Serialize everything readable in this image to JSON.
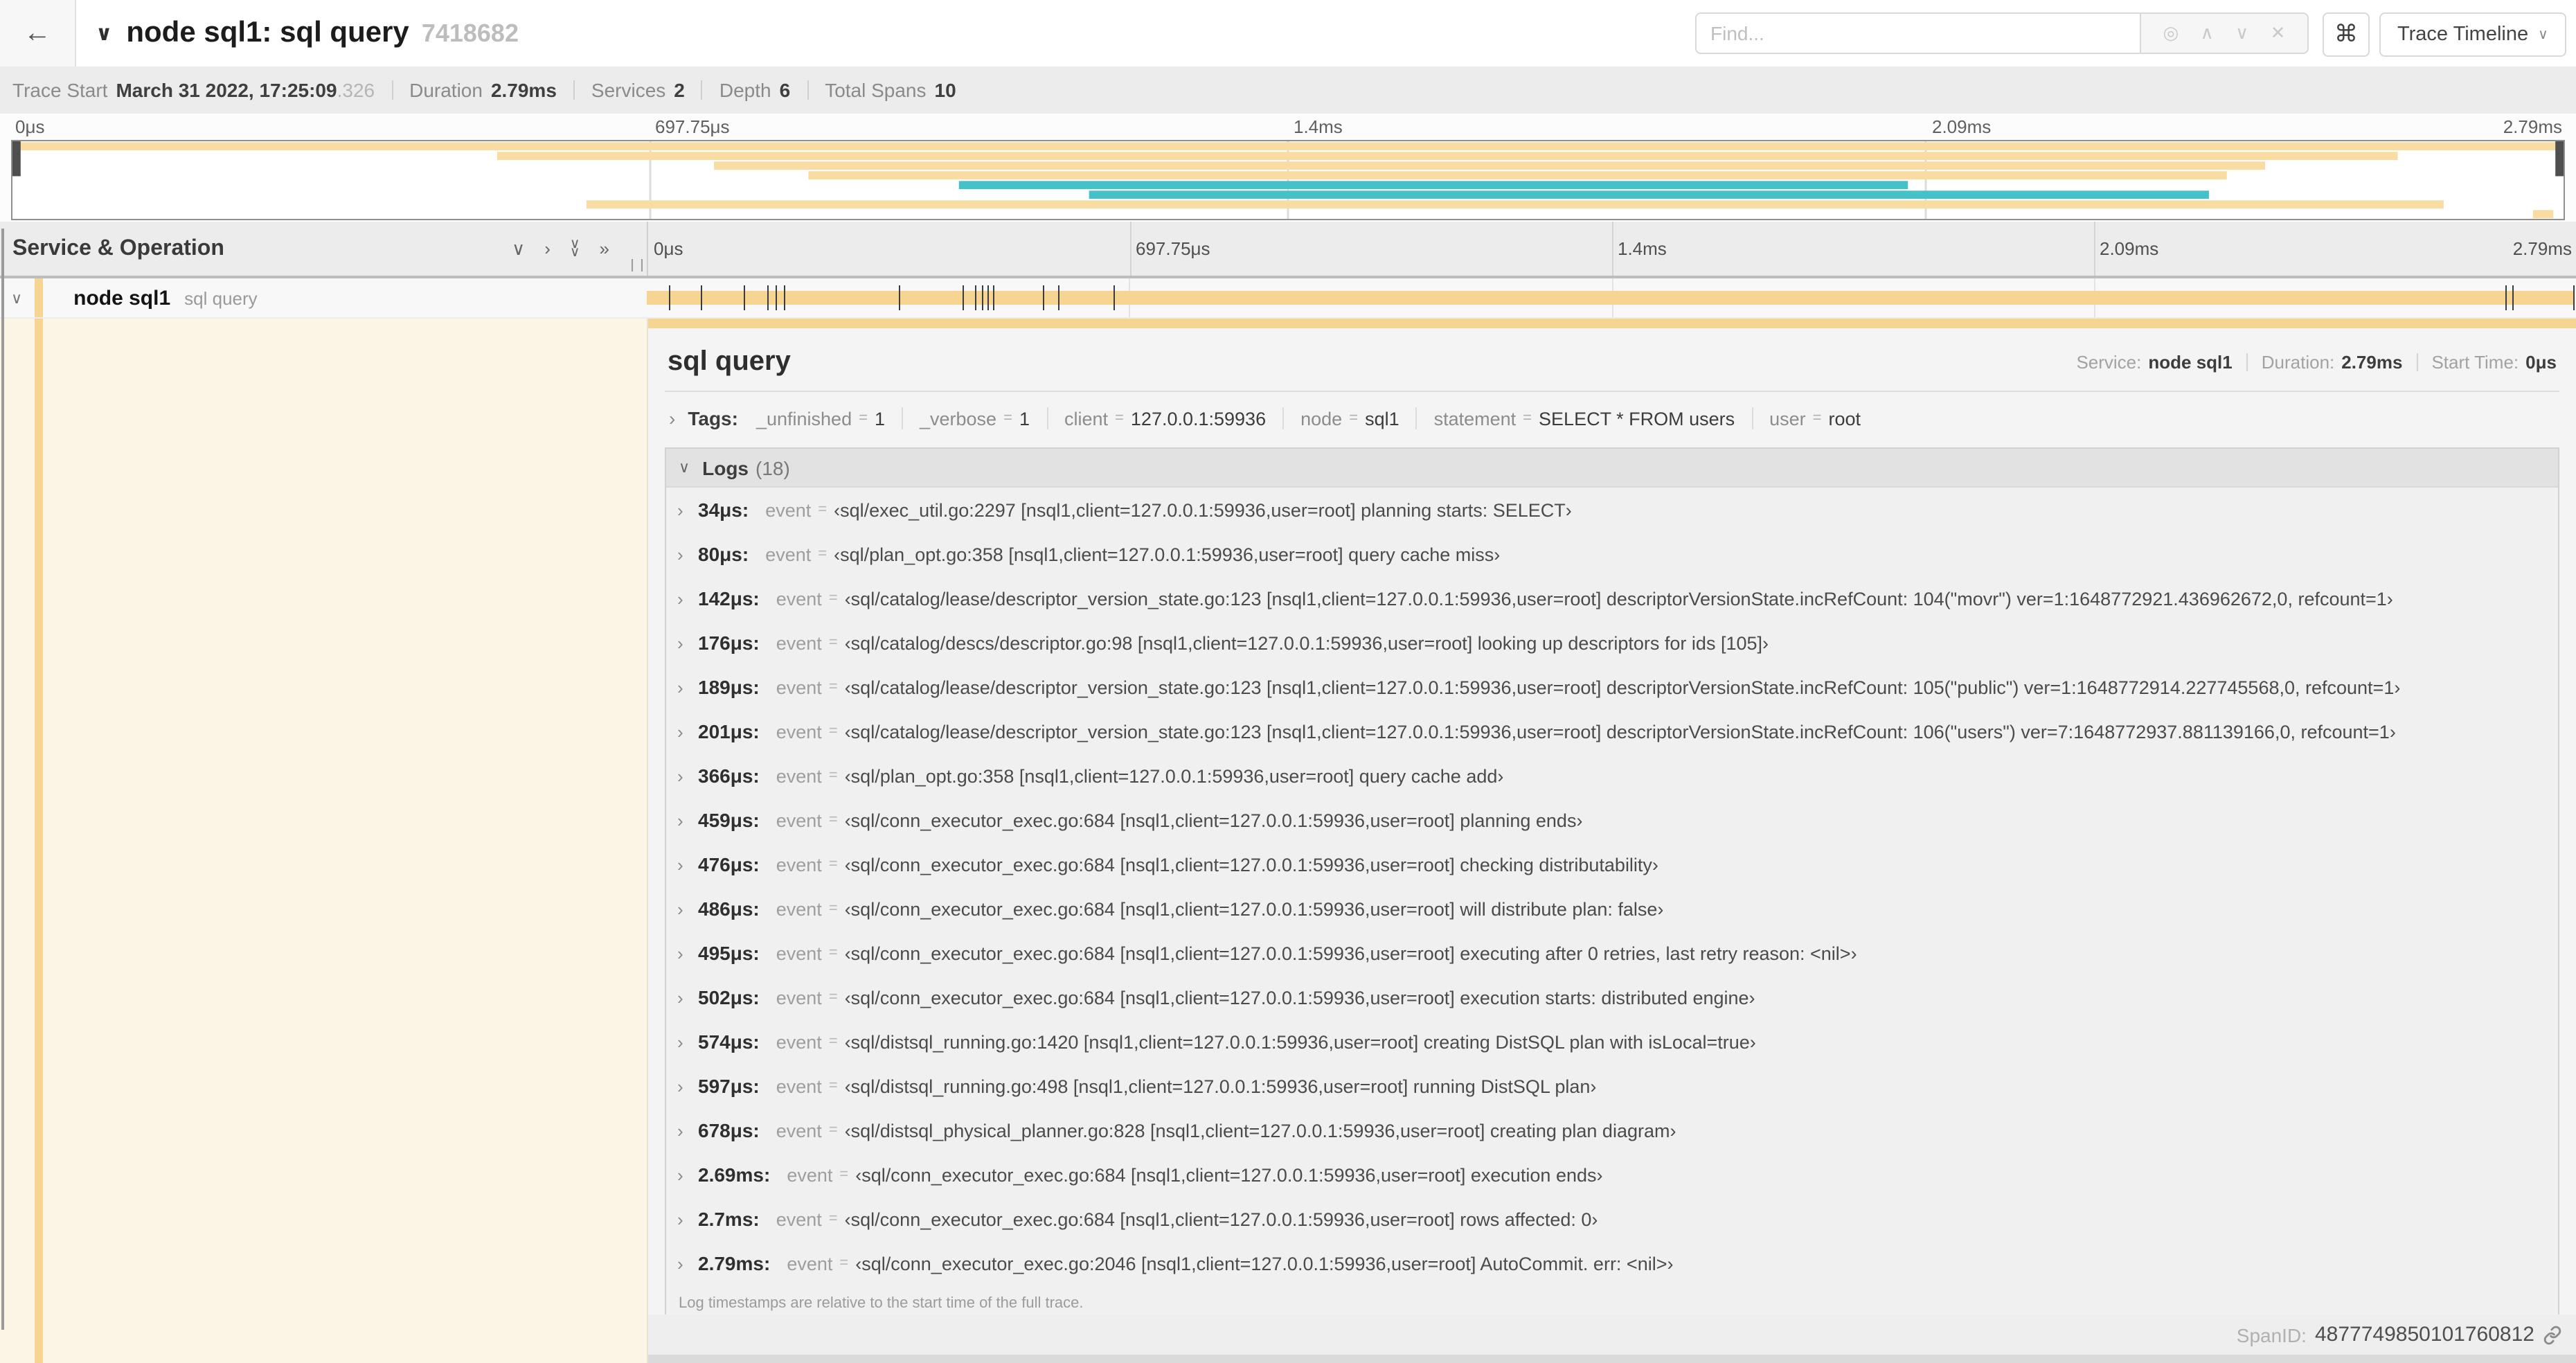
{
  "topbar": {
    "back_icon": "←",
    "title_chevron": "∨",
    "title": "node sql1: sql query",
    "trace_id": "7418682",
    "find": {
      "placeholder": "Find...",
      "target_icon": "◎",
      "prev_icon": "∧",
      "next_icon": "∨",
      "clear_icon": "✕"
    },
    "shortcut_icon": "⌘",
    "view_select": {
      "label": "Trace Timeline",
      "caret": "∨"
    }
  },
  "trace_info": {
    "items": [
      {
        "label": "Trace Start",
        "value": "March 31 2022, 17:25:09",
        "suffix": ".326"
      },
      {
        "label": "Duration",
        "value": "2.79ms"
      },
      {
        "label": "Services",
        "value": "2"
      },
      {
        "label": "Depth",
        "value": "6"
      },
      {
        "label": "Total Spans",
        "value": "10"
      }
    ]
  },
  "axis": {
    "ticks": [
      {
        "label": "0μs",
        "pos": 0
      },
      {
        "label": "697.75μs",
        "pos": 0.25
      },
      {
        "label": "1.4ms",
        "pos": 0.5
      },
      {
        "label": "2.09ms",
        "pos": 0.75
      },
      {
        "label": "2.79ms",
        "pos": 1
      }
    ]
  },
  "minimap": {
    "colors": {
      "tan": "#F8DCA1",
      "teal": "#45C2C8",
      "handle": "#4f4f4f"
    },
    "spans": [
      {
        "row": 0,
        "start": 0,
        "end": 1,
        "color": "tan"
      },
      {
        "row": 1,
        "start": 0.19,
        "end": 0.935,
        "color": "tan"
      },
      {
        "row": 2,
        "start": 0.275,
        "end": 0.883,
        "color": "tan"
      },
      {
        "row": 3,
        "start": 0.312,
        "end": 0.868,
        "color": "tan"
      },
      {
        "row": 4,
        "start": 0.371,
        "end": 0.743,
        "color": "teal"
      },
      {
        "row": 5,
        "start": 0.422,
        "end": 0.861,
        "color": "teal"
      },
      {
        "row": 6,
        "start": 0.225,
        "end": 0.953,
        "color": "tan"
      },
      {
        "row": 7,
        "start": 0.988,
        "end": 0.996,
        "color": "tan"
      }
    ],
    "handle_positions": [
      0,
      1
    ]
  },
  "span_table": {
    "header": "Service & Operation",
    "row_chevron": "∨",
    "controls": [
      {
        "name": "collapse-one",
        "glyph": "∨",
        "stack": false
      },
      {
        "name": "expand-one",
        "glyph": "›",
        "stack": false
      },
      {
        "name": "collapse-all",
        "glyph": "∨∨",
        "stack": true
      },
      {
        "name": "expand-all",
        "glyph": "»",
        "stack": false
      }
    ],
    "rows": [
      {
        "service": "node sql1",
        "operation": "sql query"
      }
    ],
    "bar_color": "#F6D492",
    "tick_fractions": [
      0.0122,
      0.0287,
      0.0509,
      0.0631,
      0.0677,
      0.072,
      0.1312,
      0.1645,
      0.1706,
      0.1742,
      0.1774,
      0.1799,
      0.2057,
      0.214,
      0.243,
      0.9642,
      0.9677,
      0.999
    ]
  },
  "detail": {
    "title": "sql query",
    "meta": [
      {
        "label": "Service:",
        "value": "node sql1"
      },
      {
        "label": "Duration:",
        "value": "2.79ms"
      },
      {
        "label": "Start Time:",
        "value": "0μs"
      }
    ],
    "tags": {
      "chevron": "›",
      "label": "Tags:",
      "eq": "=",
      "items": [
        {
          "key": "_unfinished",
          "value": "1"
        },
        {
          "key": "_verbose",
          "value": "1"
        },
        {
          "key": "client",
          "value": "127.0.0.1:59936"
        },
        {
          "key": "node",
          "value": "sql1"
        },
        {
          "key": "statement",
          "value": "SELECT * FROM users"
        },
        {
          "key": "user",
          "value": "root"
        }
      ]
    },
    "logs": {
      "chevron": "∨",
      "label": "Logs",
      "count": "(18)",
      "row_chevron": "›",
      "field": "event",
      "eq": "=",
      "entries": [
        {
          "time": "34μs:",
          "value": "‹sql/exec_util.go:2297 [nsql1,client=127.0.0.1:59936,user=root] planning starts: SELECT›"
        },
        {
          "time": "80μs:",
          "value": "‹sql/plan_opt.go:358 [nsql1,client=127.0.0.1:59936,user=root] query cache miss›"
        },
        {
          "time": "142μs:",
          "value": "‹sql/catalog/lease/descriptor_version_state.go:123 [nsql1,client=127.0.0.1:59936,user=root] descriptorVersionState.incRefCount: 104(\"movr\") ver=1:1648772921.436962672,0, refcount=1›"
        },
        {
          "time": "176μs:",
          "value": "‹sql/catalog/descs/descriptor.go:98 [nsql1,client=127.0.0.1:59936,user=root] looking up descriptors for ids [105]›"
        },
        {
          "time": "189μs:",
          "value": "‹sql/catalog/lease/descriptor_version_state.go:123 [nsql1,client=127.0.0.1:59936,user=root] descriptorVersionState.incRefCount: 105(\"public\") ver=1:1648772914.227745568,0, refcount=1›"
        },
        {
          "time": "201μs:",
          "value": "‹sql/catalog/lease/descriptor_version_state.go:123 [nsql1,client=127.0.0.1:59936,user=root] descriptorVersionState.incRefCount: 106(\"users\") ver=7:1648772937.881139166,0, refcount=1›"
        },
        {
          "time": "366μs:",
          "value": "‹sql/plan_opt.go:358 [nsql1,client=127.0.0.1:59936,user=root] query cache add›"
        },
        {
          "time": "459μs:",
          "value": "‹sql/conn_executor_exec.go:684 [nsql1,client=127.0.0.1:59936,user=root] planning ends›"
        },
        {
          "time": "476μs:",
          "value": "‹sql/conn_executor_exec.go:684 [nsql1,client=127.0.0.1:59936,user=root] checking distributability›"
        },
        {
          "time": "486μs:",
          "value": "‹sql/conn_executor_exec.go:684 [nsql1,client=127.0.0.1:59936,user=root] will distribute plan: false›"
        },
        {
          "time": "495μs:",
          "value": "‹sql/conn_executor_exec.go:684 [nsql1,client=127.0.0.1:59936,user=root] executing after 0 retries, last retry reason: <nil>›"
        },
        {
          "time": "502μs:",
          "value": "‹sql/conn_executor_exec.go:684 [nsql1,client=127.0.0.1:59936,user=root] execution starts: distributed engine›"
        },
        {
          "time": "574μs:",
          "value": "‹sql/distsql_running.go:1420 [nsql1,client=127.0.0.1:59936,user=root] creating DistSQL plan with isLocal=true›"
        },
        {
          "time": "597μs:",
          "value": "‹sql/distsql_running.go:498 [nsql1,client=127.0.0.1:59936,user=root] running DistSQL plan›"
        },
        {
          "time": "678μs:",
          "value": "‹sql/distsql_physical_planner.go:828 [nsql1,client=127.0.0.1:59936,user=root] creating plan diagram›"
        },
        {
          "time": "2.69ms:",
          "value": "‹sql/conn_executor_exec.go:684 [nsql1,client=127.0.0.1:59936,user=root] execution ends›"
        },
        {
          "time": "2.7ms:",
          "value": "‹sql/conn_executor_exec.go:684 [nsql1,client=127.0.0.1:59936,user=root] rows affected: 0›"
        },
        {
          "time": "2.79ms:",
          "value": "‹sql/conn_executor_exec.go:2046 [nsql1,client=127.0.0.1:59936,user=root] AutoCommit. err: <nil>›"
        }
      ],
      "note": "Log timestamps are relative to the start time of the full trace."
    },
    "footer": {
      "label": "SpanID:",
      "value": "4877749850101760812"
    }
  },
  "detail_colors": {
    "accent": "#F6D492",
    "left_column_bg": "#FBF5E5"
  }
}
